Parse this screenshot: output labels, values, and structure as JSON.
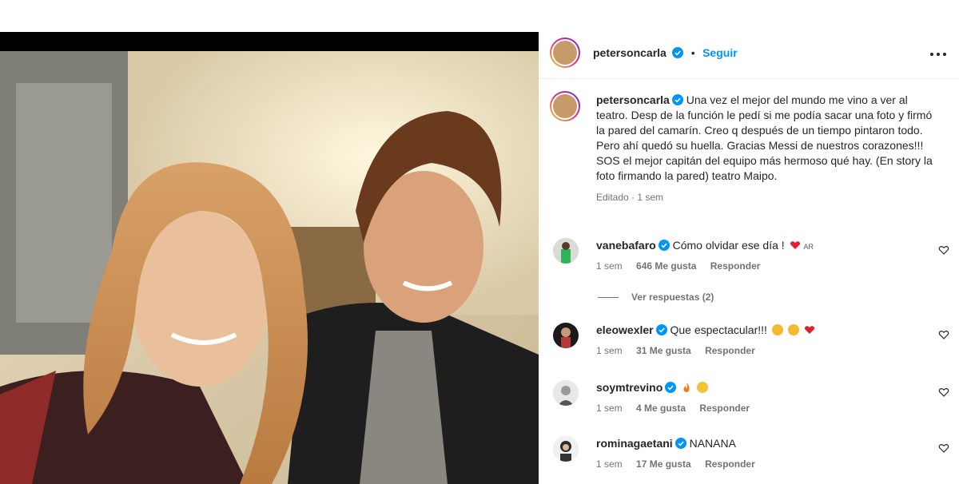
{
  "post": {
    "author": "petersoncarla",
    "follow_label": "Seguir",
    "caption_user": "petersoncarla",
    "caption_text": "Una vez el mejor del mundo me vino a ver al teatro. Desp de la función le pedí si me podía sacar una foto y firmó la pared del camarín. Creo q después de un tiempo pintaron todo. Pero ahí quedó su huella. Gracias Messi de nuestros corazones!!! SOS el mejor capitán del equipo más hermoso qué hay. (En story la foto firmando la pared) teatro Maipo.",
    "caption_meta": "Editado · 1 sem"
  },
  "comments": [
    {
      "user": "vanebafaro",
      "text": "Cómo olvidar ese día !",
      "suffix": "AR",
      "time": "1 sem",
      "likes": "646 Me gusta",
      "reply": "Responder"
    },
    {
      "user": "eleowexler",
      "text": "Que espectacular!!!",
      "time": "1 sem",
      "likes": "31 Me gusta",
      "reply": "Responder"
    },
    {
      "user": "soymtrevino",
      "text": "",
      "time": "1 sem",
      "likes": "4 Me gusta",
      "reply": "Responder"
    },
    {
      "user": "rominagaetani",
      "text": "NANANA",
      "time": "1 sem",
      "likes": "17 Me gusta",
      "reply": "Responder"
    }
  ],
  "view_replies": "Ver respuestas (2)",
  "colors": {
    "accent": "#0095f6",
    "text": "#262626",
    "muted": "#737373",
    "heart": "#ed4956"
  },
  "icons": {
    "more": "more-horizontal-icon",
    "verified": "verified-badge-icon",
    "like": "heart-outline-icon"
  }
}
